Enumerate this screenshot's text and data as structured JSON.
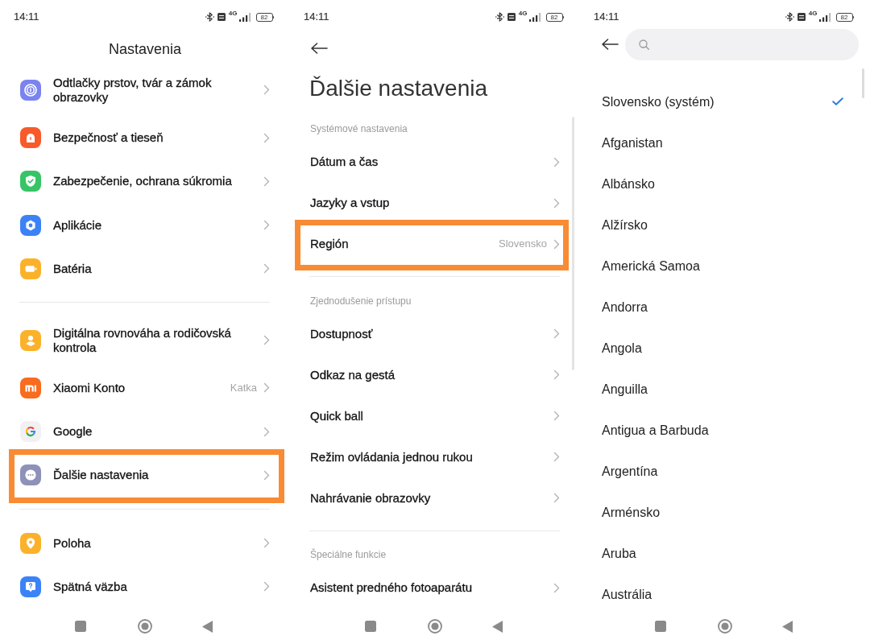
{
  "screens": [
    {
      "kind": "main",
      "status_bar": {
        "time": "14:11",
        "network": "4G",
        "battery": "82"
      },
      "title": "Nastavenia",
      "sections": [
        {
          "items": [
            {
              "label": "Odtlačky prstov, tvár a zámok obrazovky",
              "color": "#7b83ef",
              "highlighted": false
            },
            {
              "label": "Bezpečnosť a tieseň",
              "color": "#f85a2b",
              "highlighted": false
            },
            {
              "label": "Zabezpečenie, ochrana súkromia",
              "color": "#37c466",
              "highlighted": false
            },
            {
              "label": "Aplikácie",
              "color": "#3b82f6",
              "highlighted": false
            },
            {
              "label": "Batéria",
              "color": "#fbb22a",
              "highlighted": false
            }
          ]
        },
        {
          "items": [
            {
              "label": "Digitálna rovnováha a rodičovská kontrola",
              "color": "#fbb22a",
              "highlighted": false
            },
            {
              "label": "Xiaomi Konto",
              "value": "Katka",
              "color": "#f96b1e",
              "highlighted": false
            },
            {
              "label": "Google",
              "color": "#f1f1f4",
              "highlighted": false
            },
            {
              "label": "Ďalšie nastavenia",
              "color": "#8e91b8",
              "highlighted": true
            }
          ]
        },
        {
          "items": [
            {
              "label": "Poloha",
              "color": "#fbb22a",
              "highlighted": false
            },
            {
              "label": "Spätná väzba",
              "color": "#3b82f6",
              "highlighted": false
            }
          ]
        }
      ]
    },
    {
      "kind": "sub",
      "status_bar": {
        "time": "14:11",
        "network": "4G",
        "battery": "82"
      },
      "title": "Ďalšie nastavenia",
      "sections": [
        {
          "header": "Systémové nastavenia",
          "items": [
            {
              "label": "Dátum a čas",
              "highlighted": false
            },
            {
              "label": "Jazyky a vstup",
              "highlighted": false
            },
            {
              "label": "Región",
              "value": "Slovensko",
              "highlighted": true
            }
          ]
        },
        {
          "header": "Zjednodušenie prístupu",
          "items": [
            {
              "label": "Dostupnosť",
              "highlighted": false
            },
            {
              "label": "Odkaz na gestá",
              "highlighted": false
            },
            {
              "label": "Quick ball",
              "highlighted": false
            },
            {
              "label": "Režim ovládania jednou rukou",
              "highlighted": false
            },
            {
              "label": "Nahrávanie obrazovky",
              "highlighted": false
            }
          ]
        },
        {
          "header": "Špeciálne funkcie",
          "items": [
            {
              "label": "Asistent predného fotoaparátu",
              "highlighted": false
            }
          ]
        }
      ]
    },
    {
      "kind": "picker",
      "status_bar": {
        "time": "14:11",
        "network": "4G",
        "battery": "82"
      },
      "items": [
        {
          "label": "Slovensko (systém)",
          "selected": true
        },
        {
          "label": "Afganistan",
          "selected": false
        },
        {
          "label": "Albánsko",
          "selected": false
        },
        {
          "label": "Alžírsko",
          "selected": false
        },
        {
          "label": "Americká Samoa",
          "selected": false
        },
        {
          "label": "Andorra",
          "selected": false
        },
        {
          "label": "Angola",
          "selected": false
        },
        {
          "label": "Anguilla",
          "selected": false
        },
        {
          "label": "Antigua a Barbuda",
          "selected": false
        },
        {
          "label": "Argentína",
          "selected": false
        },
        {
          "label": "Arménsko",
          "selected": false
        },
        {
          "label": "Aruba",
          "selected": false
        },
        {
          "label": "Austrália",
          "selected": false
        }
      ]
    }
  ]
}
